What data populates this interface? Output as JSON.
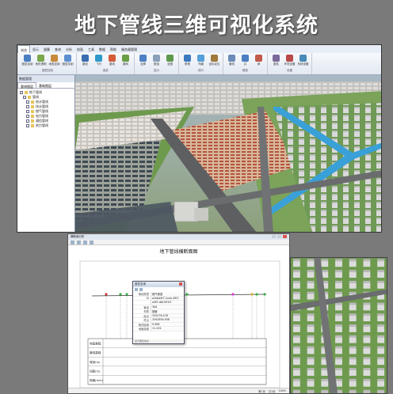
{
  "page_title": "地下管线三维可视化系统",
  "app": {
    "menu": [
      "浏览",
      "显示",
      "量算",
      "查询",
      "分析",
      "剖面",
      "工具",
      "数据",
      "帮助",
      "服务器管理"
    ],
    "active_menu": "浏览",
    "ribbon_groups": [
      {
        "label": "图层控制",
        "buttons": [
          "图层控制",
          "地形透明",
          "地表控制",
          "图层控制"
        ],
        "colors": [
          "#4a7fc1",
          "#7aa84c",
          "#c88a3a",
          "#5c8fd0"
        ]
      },
      {
        "label": "漫游",
        "buttons": [
          "路径",
          "飞行",
          "路线",
          "路网"
        ],
        "colors": [
          "#3b6db0",
          "#2f9ac9",
          "#d45a3a",
          "#6a9e44"
        ]
      },
      {
        "label": "显示",
        "buttons": [
          "全屏",
          "框选",
          "全图"
        ],
        "colors": [
          "#4b80c4",
          "#8aa0b8",
          "#5d9a4c"
        ]
      },
      {
        "label": "视口",
        "buttons": [
          "俯视",
          "鸟瞰",
          "坐标定位"
        ],
        "colors": [
          "#3a7abf",
          "#55a0d8",
          "#a07a3a"
        ]
      },
      {
        "label": "模型",
        "buttons": [
          "管线",
          "井",
          "阀"
        ],
        "colors": [
          "#6b8cb8",
          "#4c7fbf",
          "#c25a4a"
        ]
      },
      {
        "label": "设置",
        "buttons": [
          "属性",
          "环境设置",
          "系统设置"
        ],
        "colors": [
          "#7a6a9c",
          "#b84a4a",
          "#4a8ab8"
        ]
      }
    ],
    "side_panel": {
      "header": "数据管理",
      "tabs": [
        "管线图层",
        "基础图层"
      ],
      "active_tab": "管线图层",
      "tree": [
        "地下管线",
        "管线",
        "给水管线",
        "排水管线",
        "燃气管线",
        "电力管线",
        "通信管线",
        "热力管线"
      ]
    }
  },
  "doc": {
    "window_title": "横断面分析",
    "heading": "地下管线横断面图",
    "table_rows": [
      "地面高程",
      "管线高程",
      "埋深(m)",
      "间距(m)",
      "规格(mm)"
    ],
    "status_items": [
      "第1页",
      "共1页",
      "100%"
    ],
    "popup": {
      "title": "属性查询",
      "rows": [
        {
          "k": "管线类型",
          "v": "煤气管道"
        },
        {
          "k": "ID",
          "v": "a2ebd4f7-1cee-49f1"
        },
        {
          "k": "",
          "v": "a4f5-db1f4f1f1"
        },
        {
          "k": "管径",
          "v": "300"
        },
        {
          "k": "材质",
          "v": "钢管"
        },
        {
          "k": "起点",
          "v": "355276.476"
        },
        {
          "k": "终点",
          "v": "3592890.958"
        },
        {
          "k": "管顶高程",
          "v": "9.908"
        },
        {
          "k": "地面高程",
          "v": "11.434"
        }
      ],
      "status": "显示属性信息"
    }
  }
}
